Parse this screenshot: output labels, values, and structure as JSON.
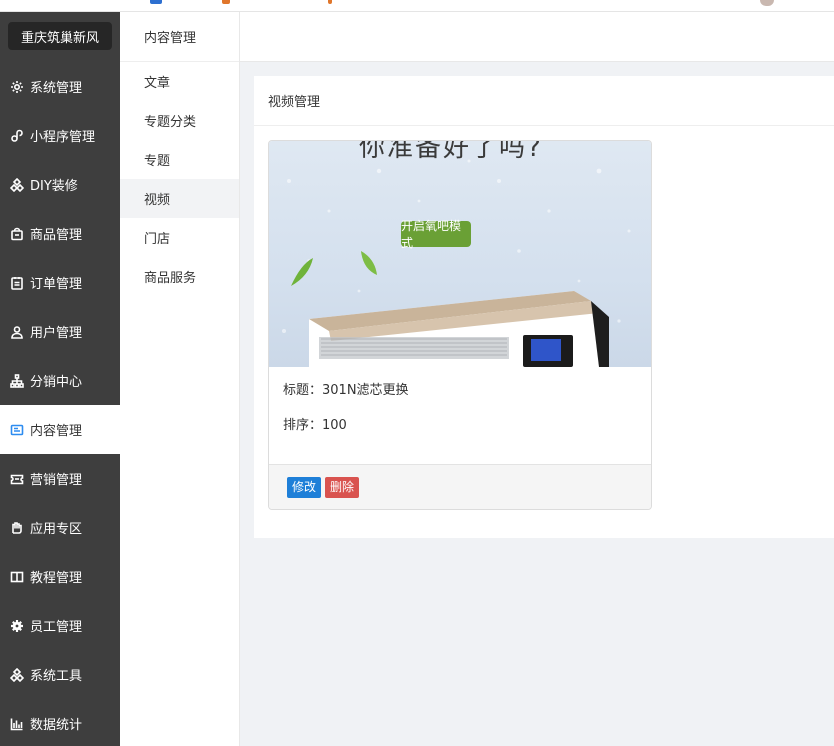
{
  "brand": "重庆筑巢新风",
  "sidebar": {
    "items": [
      {
        "label": "系统管理",
        "icon": "gear-icon",
        "active": false
      },
      {
        "label": "小程序管理",
        "icon": "link-icon",
        "active": false
      },
      {
        "label": "DIY装修",
        "icon": "diamond-icon",
        "active": false
      },
      {
        "label": "商品管理",
        "icon": "bag-icon",
        "active": false
      },
      {
        "label": "订单管理",
        "icon": "clipboard-icon",
        "active": false
      },
      {
        "label": "用户管理",
        "icon": "user-icon",
        "active": false
      },
      {
        "label": "分销中心",
        "icon": "hierarchy-icon",
        "active": false
      },
      {
        "label": "内容管理",
        "icon": "content-icon",
        "active": true
      },
      {
        "label": "营销管理",
        "icon": "ticket-icon",
        "active": false
      },
      {
        "label": "应用专区",
        "icon": "hand-icon",
        "active": false
      },
      {
        "label": "教程管理",
        "icon": "book-icon",
        "active": false
      },
      {
        "label": "员工管理",
        "icon": "cog-solid-icon",
        "active": false
      },
      {
        "label": "系统工具",
        "icon": "diamond-icon",
        "active": false
      },
      {
        "label": "数据统计",
        "icon": "bar-chart-icon",
        "active": false
      }
    ]
  },
  "subside": {
    "title": "内容管理",
    "items": [
      {
        "label": "文章"
      },
      {
        "label": "专题分类"
      },
      {
        "label": "专题"
      },
      {
        "label": "视频"
      },
      {
        "label": "门店"
      },
      {
        "label": "商品服务"
      }
    ]
  },
  "panel": {
    "title": "视频管理"
  },
  "card": {
    "thumb_text": "你准备好了吗?",
    "thumb_badge": "开启氧吧模式",
    "title_line": "标题：301N滤芯更换",
    "sort_line": "排序：100",
    "edit_label": "修改",
    "delete_label": "删除"
  },
  "colors": {
    "sidebar_bg": "#3e3e3e",
    "active_icon": "#2d8cf0",
    "edit_btn": "#1e7fd8",
    "delete_btn": "#d9534f"
  }
}
